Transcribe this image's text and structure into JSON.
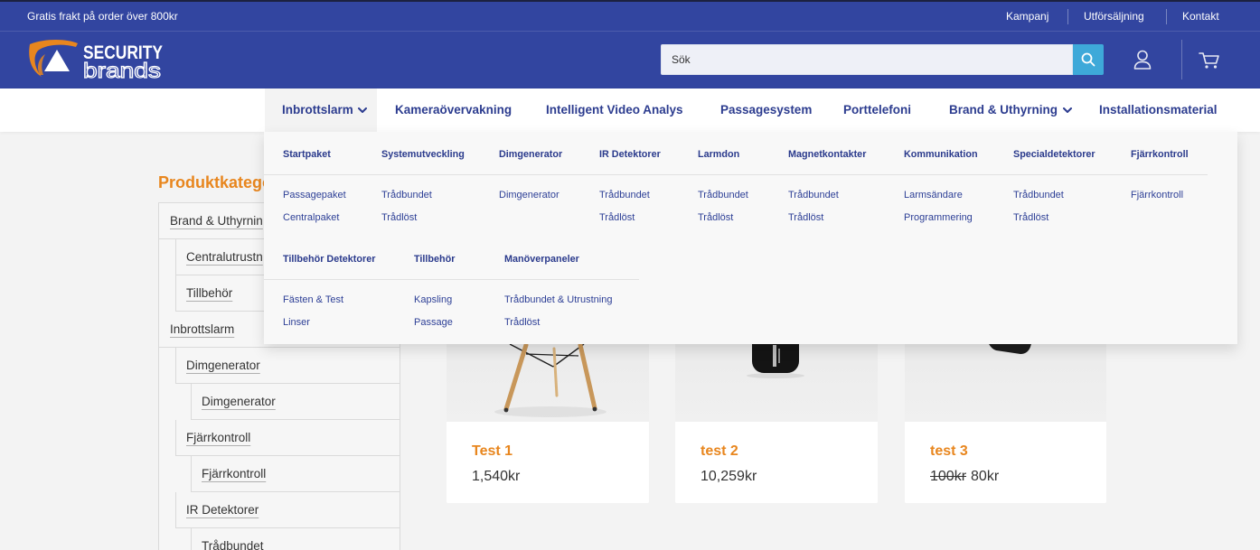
{
  "colors": {
    "brand_blue": "#3245a0",
    "accent_orange": "#e8861e",
    "search_button": "#3ea9d9",
    "nav_text": "#2c3c8f",
    "page_bg": "#f3f3f3"
  },
  "topbar": {
    "promo": "Gratis frakt på order över 800kr",
    "links": [
      "Kampanj",
      "Utförsäljning",
      "Kontakt"
    ]
  },
  "header": {
    "logo_line1": "SECURITY",
    "logo_line2": "brands",
    "search_placeholder": "Sök",
    "icons": [
      "search-icon",
      "user-icon",
      "cart-icon"
    ]
  },
  "nav": {
    "items": [
      {
        "label": "Inbrottslarm",
        "dropdown": true,
        "active": true
      },
      {
        "label": "Kameraövervakning",
        "dropdown": false,
        "active": false
      },
      {
        "label": "Intelligent Video Analys",
        "dropdown": false,
        "active": false
      },
      {
        "label": "Passagesystem",
        "dropdown": false,
        "active": false
      },
      {
        "label": "Porttelefoni",
        "dropdown": false,
        "active": false
      },
      {
        "label": "Brand & Uthyrning",
        "dropdown": true,
        "active": false
      },
      {
        "label": "Installationsmaterial",
        "dropdown": false,
        "active": false
      }
    ]
  },
  "mega_menu": {
    "groups": [
      {
        "heading": "Startpaket",
        "links": [
          "Passagepaket",
          "Centralpaket"
        ]
      },
      {
        "heading": "Systemutveckling",
        "links": [
          "Trådbundet",
          "Trådlöst"
        ]
      },
      {
        "heading": "Dimgenerator",
        "links": [
          "Dimgenerator"
        ]
      },
      {
        "heading": "IR Detektorer",
        "links": [
          "Trådbundet",
          "Trådlöst"
        ]
      },
      {
        "heading": "Larmdon",
        "links": [
          "Trådbundet",
          "Trådlöst"
        ]
      },
      {
        "heading": "Magnetkontakter",
        "links": [
          "Trådbundet",
          "Trådlöst"
        ]
      },
      {
        "heading": "Kommunikation",
        "links": [
          "Larmsändare",
          "Programmering"
        ]
      },
      {
        "heading": "Specialdetektorer",
        "links": [
          "Trådbundet",
          "Trådlöst"
        ]
      },
      {
        "heading": "Fjärrkontroll",
        "links": [
          "Fjärrkontroll"
        ]
      },
      {
        "heading": "Tillbehör Detektorer",
        "links": [
          "Fästen & Test",
          "Linser"
        ]
      },
      {
        "heading": "Tillbehör",
        "links": [
          "Kapsling",
          "Passage"
        ]
      },
      {
        "heading": "Manöverpaneler",
        "links": [
          "Trådbundet & Utrustning",
          "Trådlöst"
        ]
      }
    ]
  },
  "sidebar": {
    "title": "Produktkatego",
    "items": [
      {
        "label": "Brand & Uthyrnin",
        "level": 1
      },
      {
        "label": "Centralutrustn",
        "level": 2
      },
      {
        "label": "Tillbehör",
        "level": 2
      },
      {
        "label": "Inbrottslarm",
        "level": 1
      },
      {
        "label": "Dimgenerator",
        "level": 2
      },
      {
        "label": "Dimgenerator",
        "level": 3
      },
      {
        "label": "Fjärrkontroll",
        "level": 2
      },
      {
        "label": "Fjärrkontroll",
        "level": 3
      },
      {
        "label": "IR Detektorer",
        "level": 2
      },
      {
        "label": "Trådbundet",
        "level": 3
      }
    ]
  },
  "products": [
    {
      "name": "Test 1",
      "price": "1,540kr"
    },
    {
      "name": "test 2",
      "price": "10,259kr"
    },
    {
      "name": "test 3",
      "old_price": "100kr",
      "price": "80kr"
    }
  ]
}
